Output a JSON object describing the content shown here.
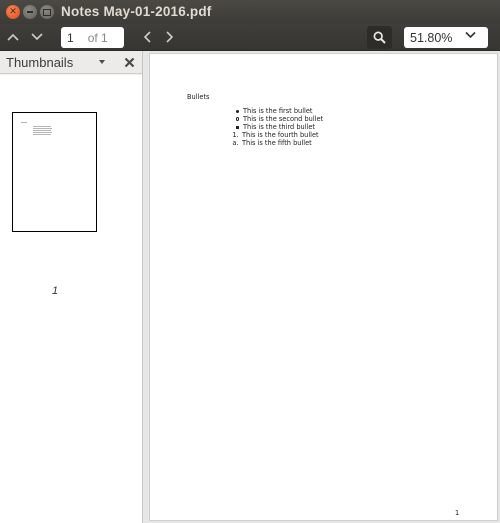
{
  "window": {
    "title": "Notes May-01-2016.pdf"
  },
  "toolbar": {
    "page_current": "1",
    "page_total": "of 1",
    "zoom": "51.80%"
  },
  "sidebar": {
    "title": "Thumbnails",
    "thumbnails": [
      {
        "label": "1"
      }
    ]
  },
  "document": {
    "heading": "Bullets",
    "items": [
      {
        "marker": "disc",
        "text": "This is the first bullet"
      },
      {
        "marker": "circle",
        "text": "This is the second bullet"
      },
      {
        "marker": "square",
        "text": "This is the third bullet"
      },
      {
        "marker": "1.",
        "text": "This is the fourth bullet"
      },
      {
        "marker": "a.",
        "text": "This is the fifth bullet"
      }
    ],
    "page_number": "1"
  }
}
